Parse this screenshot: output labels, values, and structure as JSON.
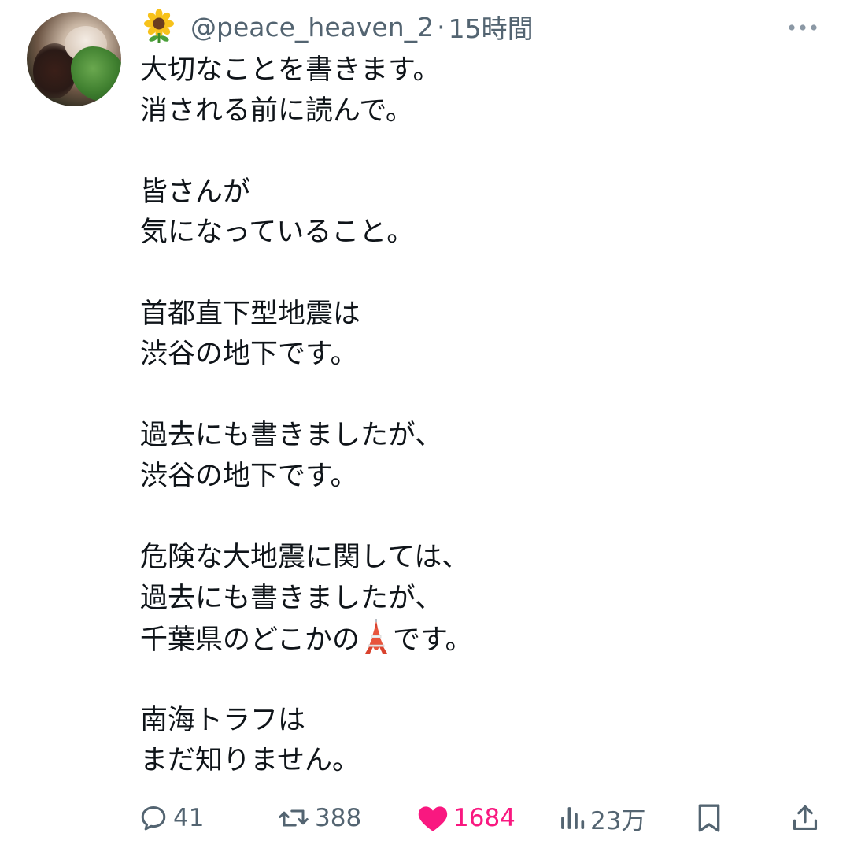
{
  "author": {
    "emoji_icon": "sunflower-icon",
    "handle": "@peace_heaven_2",
    "separator": "·",
    "time": "15時間"
  },
  "tweet": {
    "lines": [
      "大切なことを書きます。",
      "消される前に読んで。",
      "",
      "皆さんが",
      "気になっていること。",
      "",
      "首都直下型地震は",
      "渋谷の地下です。",
      "",
      "過去にも書きましたが、",
      "渋谷の地下です。",
      "",
      "危険な大地震に関しては、",
      "過去にも書きましたが、",
      "千葉県のどこかの",
      "",
      "南海トラフは",
      "まだ知りません。"
    ],
    "tower_line_suffix": "です。",
    "tower_emoji": "tokyo-tower-icon"
  },
  "actions": {
    "reply_count": "41",
    "retweet_count": "388",
    "like_count": "1684",
    "views_count": "23万"
  },
  "colors": {
    "text": "#0f1419",
    "secondary": "#536471",
    "like": "#f91880"
  }
}
